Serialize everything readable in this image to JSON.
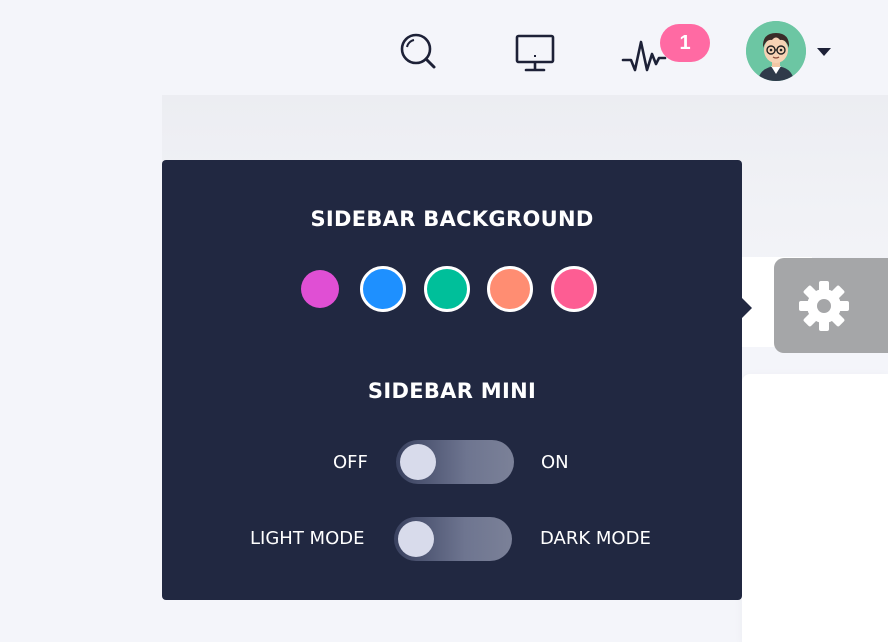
{
  "navbar": {
    "search_icon": "search-icon",
    "monitor_icon": "monitor-icon",
    "activity_icon": "activity-icon",
    "notification_count": "1",
    "badge_color": "#ff6aa3",
    "avatar_icon": "user-avatar",
    "caret_icon": "caret-down-icon"
  },
  "settings": {
    "sidebar_background": {
      "title": "SIDEBAR BACKGROUND",
      "swatches": [
        {
          "color": "#e04fd4",
          "active": true
        },
        {
          "color": "#1e90ff",
          "active": false
        },
        {
          "color": "#00bf9a",
          "active": false
        },
        {
          "color": "#ff8d72",
          "active": false
        },
        {
          "color": "#fd5d93",
          "active": false
        }
      ]
    },
    "sidebar_mini": {
      "title": "SIDEBAR MINI",
      "off_label": "OFF",
      "on_label": "ON",
      "enabled": false
    },
    "mode": {
      "light_label": "LIGHT MODE",
      "dark_label": "DARK MODE",
      "dark_enabled": false
    },
    "panel_color": "#212841",
    "gear_icon": "gear-icon"
  }
}
